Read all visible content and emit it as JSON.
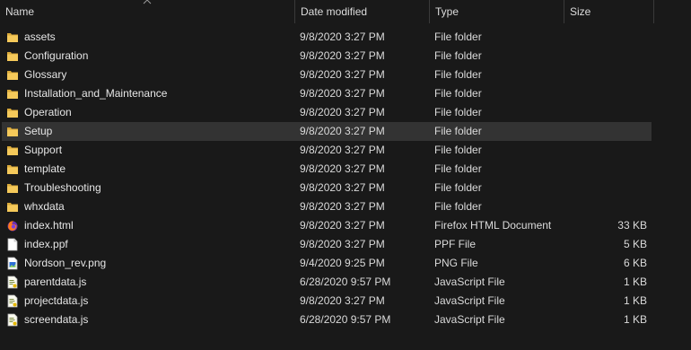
{
  "header": {
    "name_label": "Name",
    "date_label": "Date modified",
    "type_label": "Type",
    "size_label": "Size",
    "sort_icon": "chevron-up-icon"
  },
  "colors": {
    "background": "#191919",
    "selected_row": "#333333",
    "folder": "#f2c94c",
    "text": "#e6e6e6"
  },
  "files": [
    {
      "name": "assets",
      "date": "9/8/2020 3:27 PM",
      "type": "File folder",
      "size": "",
      "icon": "folder-icon"
    },
    {
      "name": "Configuration",
      "date": "9/8/2020 3:27 PM",
      "type": "File folder",
      "size": "",
      "icon": "folder-icon"
    },
    {
      "name": "Glossary",
      "date": "9/8/2020 3:27 PM",
      "type": "File folder",
      "size": "",
      "icon": "folder-icon"
    },
    {
      "name": "Installation_and_Maintenance",
      "date": "9/8/2020 3:27 PM",
      "type": "File folder",
      "size": "",
      "icon": "folder-icon"
    },
    {
      "name": "Operation",
      "date": "9/8/2020 3:27 PM",
      "type": "File folder",
      "size": "",
      "icon": "folder-icon"
    },
    {
      "name": "Setup",
      "date": "9/8/2020 3:27 PM",
      "type": "File folder",
      "size": "",
      "icon": "folder-icon",
      "selected": true
    },
    {
      "name": "Support",
      "date": "9/8/2020 3:27 PM",
      "type": "File folder",
      "size": "",
      "icon": "folder-icon"
    },
    {
      "name": "template",
      "date": "9/8/2020 3:27 PM",
      "type": "File folder",
      "size": "",
      "icon": "folder-icon"
    },
    {
      "name": "Troubleshooting",
      "date": "9/8/2020 3:27 PM",
      "type": "File folder",
      "size": "",
      "icon": "folder-icon"
    },
    {
      "name": "whxdata",
      "date": "9/8/2020 3:27 PM",
      "type": "File folder",
      "size": "",
      "icon": "folder-icon"
    },
    {
      "name": "index.html",
      "date": "9/8/2020 3:27 PM",
      "type": "Firefox HTML Document",
      "size": "33 KB",
      "icon": "firefox-html-icon"
    },
    {
      "name": "index.ppf",
      "date": "9/8/2020 3:27 PM",
      "type": "PPF File",
      "size": "5 KB",
      "icon": "blank-file-icon"
    },
    {
      "name": "Nordson_rev.png",
      "date": "9/4/2020 9:25 PM",
      "type": "PNG File",
      "size": "6 KB",
      "icon": "image-file-icon"
    },
    {
      "name": "parentdata.js",
      "date": "6/28/2020 9:57 PM",
      "type": "JavaScript File",
      "size": "1 KB",
      "icon": "script-file-icon"
    },
    {
      "name": "projectdata.js",
      "date": "9/8/2020 3:27 PM",
      "type": "JavaScript File",
      "size": "1 KB",
      "icon": "script-file-icon"
    },
    {
      "name": "screendata.js",
      "date": "6/28/2020 9:57 PM",
      "type": "JavaScript File",
      "size": "1 KB",
      "icon": "script-file-icon"
    }
  ]
}
